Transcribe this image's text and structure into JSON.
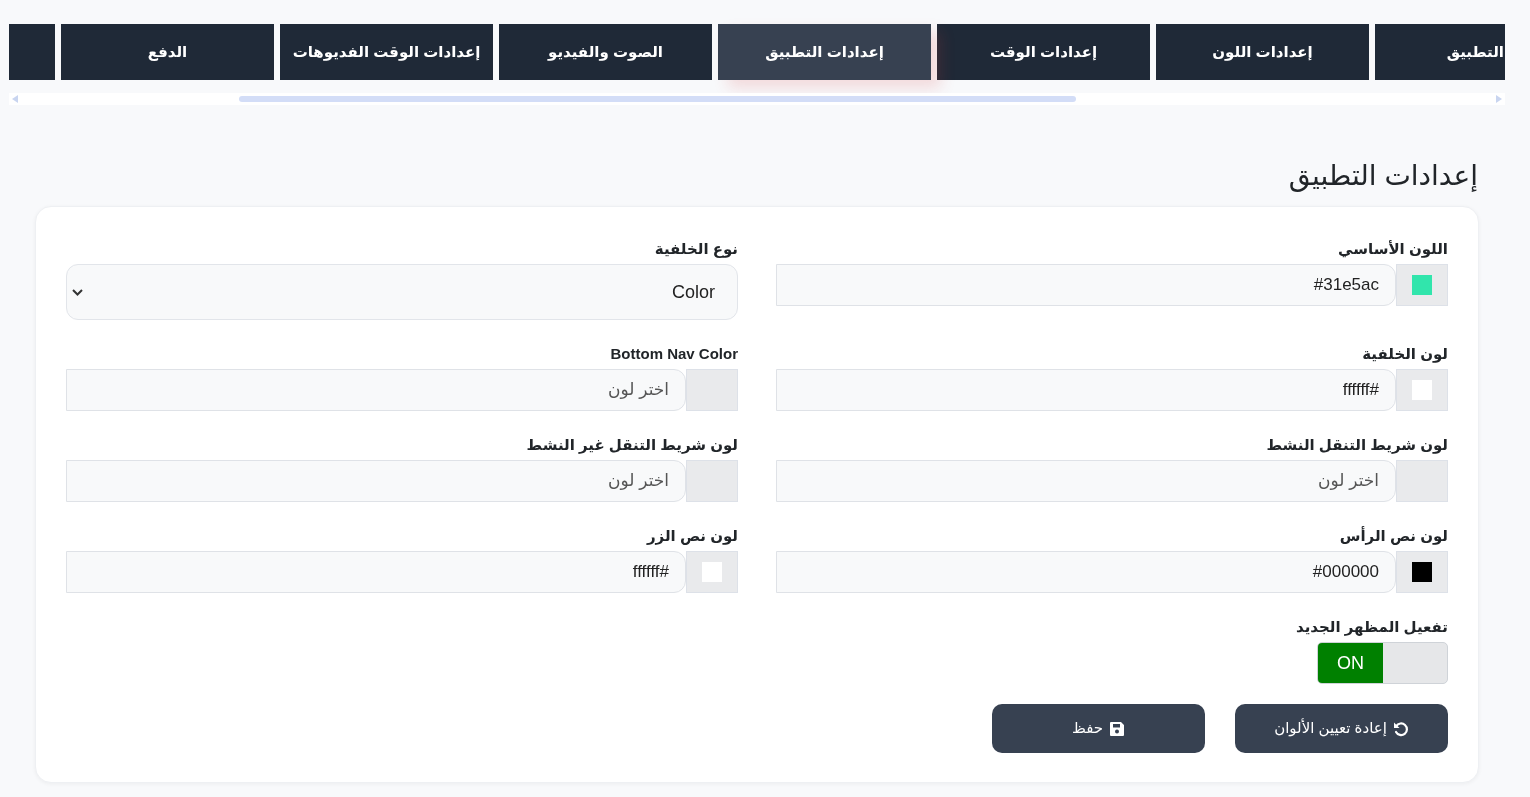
{
  "tabs": [
    {
      "label": "التطبيق",
      "selected": false
    },
    {
      "label": "إعدادات اللون",
      "selected": false
    },
    {
      "label": "إعدادات الوقت",
      "selected": false
    },
    {
      "label": "إعدادات التطبيق",
      "selected": true
    },
    {
      "label": "الصوت والفيديو",
      "selected": false
    },
    {
      "label": "إعدادات الوقت الفديوهات",
      "selected": false
    },
    {
      "label": "الدفع",
      "selected": false
    },
    {
      "selected": false
    }
  ],
  "page_title": "إعدادات التطبيق",
  "settings_form": {
    "fields": [
      {
        "kind": "color",
        "label": "اللون الأساسي",
        "value": "#31e5ac",
        "color": "#31e5ac"
      },
      {
        "kind": "select",
        "label": "نوع الخلفية",
        "value": "Color"
      },
      {
        "kind": "color",
        "label": "لون الخلفية",
        "value": "ffffff#",
        "color": "#ffffff"
      },
      {
        "kind": "color",
        "label": "Bottom Nav Color",
        "placeholder": "اختر لون"
      },
      {
        "kind": "color",
        "label": "لون شريط التنقل النشط",
        "placeholder": "اختر لون"
      },
      {
        "kind": "color",
        "label": "لون شريط التنقل غير النشط",
        "placeholder": "اختر لون"
      },
      {
        "kind": "color",
        "label": "لون نص الرأس",
        "value": "#000000",
        "color": "#000000"
      },
      {
        "kind": "color",
        "label": "لون نص الزر",
        "value": "ffffff#",
        "color": "#ffffff"
      },
      {
        "kind": "toggle",
        "label": "تفعيل المظهر الجديد",
        "on": true,
        "state_text": "ON"
      }
    ],
    "buttons": [
      {
        "kind": "reset",
        "label": "إعادة تعيين الألوان"
      },
      {
        "kind": "save",
        "label": "حفظ"
      }
    ]
  }
}
